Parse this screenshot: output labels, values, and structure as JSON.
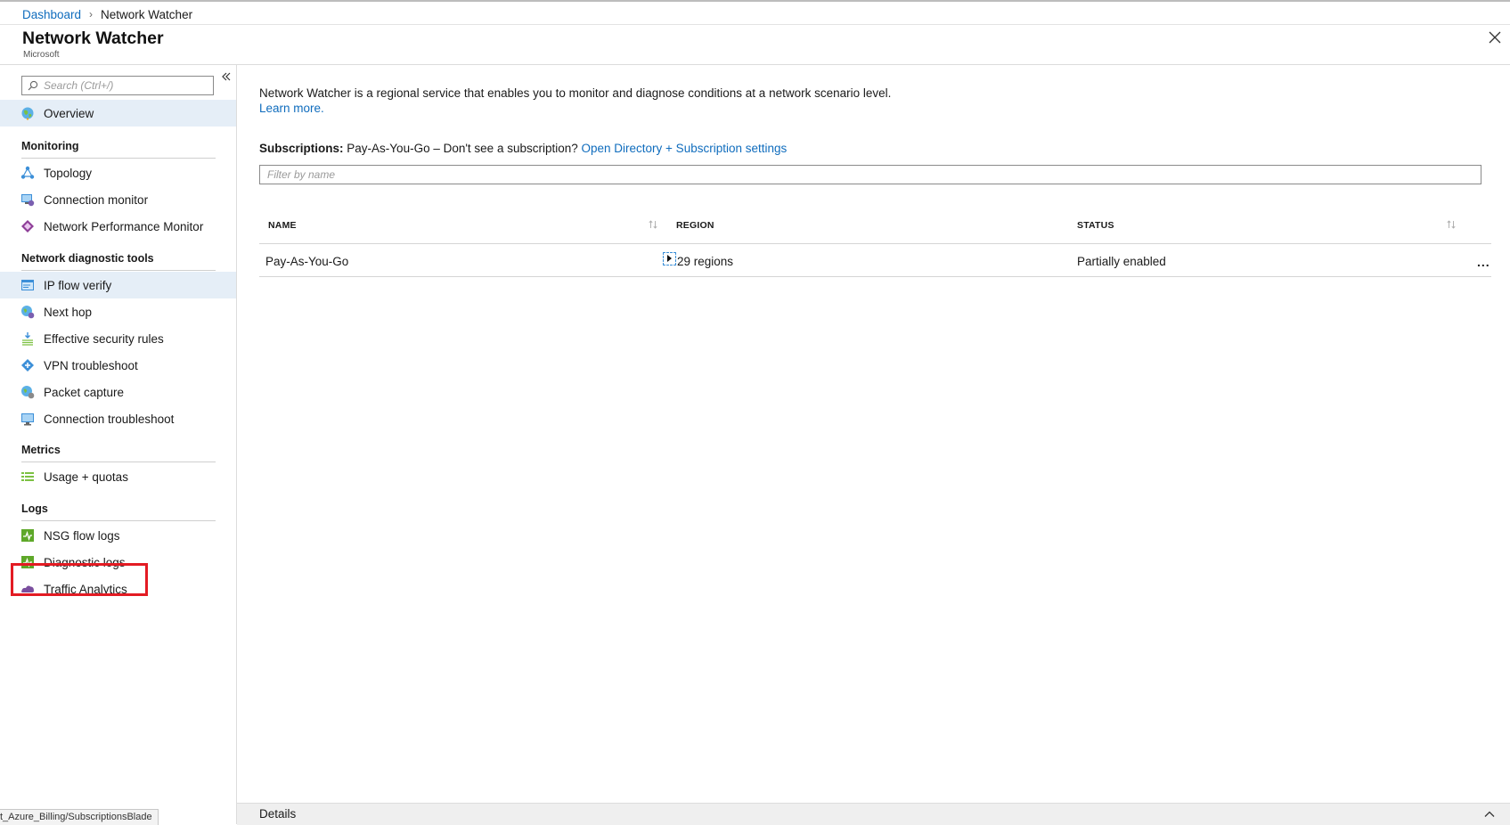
{
  "breadcrumb": {
    "root": "Dashboard",
    "current": "Network Watcher"
  },
  "blade": {
    "title": "Network Watcher",
    "subtitle": "Microsoft"
  },
  "sidebar": {
    "search_placeholder": "Search (Ctrl+/)",
    "overview_label": "Overview",
    "sections": {
      "monitoring": {
        "heading": "Monitoring",
        "items": [
          {
            "label": "Topology",
            "icon": "topology-icon"
          },
          {
            "label": "Connection monitor",
            "icon": "connection-monitor-icon"
          },
          {
            "label": "Network Performance Monitor",
            "icon": "network-performance-monitor-icon"
          }
        ]
      },
      "diagnostic": {
        "heading": "Network diagnostic tools",
        "items": [
          {
            "label": "IP flow verify",
            "icon": "ip-flow-verify-icon"
          },
          {
            "label": "Next hop",
            "icon": "next-hop-icon"
          },
          {
            "label": "Effective security rules",
            "icon": "effective-security-rules-icon"
          },
          {
            "label": "VPN troubleshoot",
            "icon": "vpn-troubleshoot-icon"
          },
          {
            "label": "Packet capture",
            "icon": "packet-capture-icon"
          },
          {
            "label": "Connection troubleshoot",
            "icon": "connection-troubleshoot-icon"
          }
        ]
      },
      "metrics": {
        "heading": "Metrics",
        "items": [
          {
            "label": "Usage + quotas",
            "icon": "usage-quotas-icon"
          }
        ]
      },
      "logs": {
        "heading": "Logs",
        "items": [
          {
            "label": "NSG flow logs",
            "icon": "nsg-flow-logs-icon"
          },
          {
            "label": "Diagnostic logs",
            "icon": "diagnostic-logs-icon"
          },
          {
            "label": "Traffic Analytics",
            "icon": "traffic-analytics-icon"
          }
        ]
      }
    }
  },
  "main": {
    "intro_text": "Network Watcher is a regional service that enables you to monitor and diagnose conditions at a network scenario level.",
    "learn_more": "Learn more.",
    "subscriptions_label": "Subscriptions:",
    "subscriptions_value": "Pay-As-You-Go – Don't see a subscription?",
    "subscriptions_link": "Open Directory + Subscription settings",
    "filter_placeholder": "Filter by name",
    "table": {
      "columns": [
        "NAME",
        "REGION",
        "STATUS"
      ],
      "rows": [
        {
          "name": "Pay-As-You-Go",
          "region": "29 regions",
          "status": "Partially enabled",
          "more": "..."
        }
      ]
    }
  },
  "details_label": "Details",
  "status_bar_text": "t_Azure_Billing/SubscriptionsBlade",
  "colors": {
    "link": "#0f6cbd",
    "selected_bg": "#e5eef7",
    "highlight_border": "#e31b23"
  }
}
